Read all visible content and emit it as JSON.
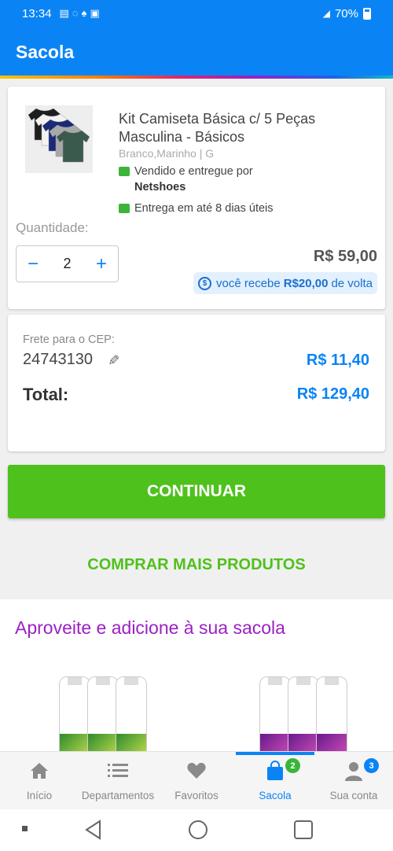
{
  "status_bar": {
    "time": "13:34",
    "notification_icons": [
      "notes-icon",
      "whatsapp-icon",
      "app-icon",
      "gallery-icon"
    ],
    "battery": "70%"
  },
  "header": {
    "title": "Sacola"
  },
  "product": {
    "title": "Kit Camiseta Básica c/ 5 Peças Masculina - Básicos",
    "variant": "Branco,Marinho | G",
    "seller_prefix": "Vendido e entregue por",
    "seller_name": "Netshoes",
    "delivery": "Entrega em até 8 dias úteis",
    "quantity_label": "Quantidade:",
    "quantity": "2",
    "price": "R$ 59,00",
    "cashback_prefix": "você recebe",
    "cashback_value": "R$20,00",
    "cashback_suffix": "de volta",
    "shirt_colors": [
      "#1e1e1e",
      "#f2f2f2",
      "#1a2a78",
      "#a8a8a8",
      "#3b5a4e"
    ]
  },
  "totals": {
    "cep_label": "Frete para o CEP:",
    "cep": "24743130",
    "frete_price": "R$ 11,40",
    "total_label": "Total:",
    "total_price": "R$ 129,40"
  },
  "actions": {
    "continue": "CONTINUAR",
    "buy_more": "COMPRAR MAIS PRODUTOS"
  },
  "suggestions": {
    "title": "Aproveite e adicione à sua sacola"
  },
  "bottom_nav": {
    "items": [
      {
        "label": "Início",
        "icon": "home-icon"
      },
      {
        "label": "Departamentos",
        "icon": "menu-icon"
      },
      {
        "label": "Favoritos",
        "icon": "heart-icon"
      },
      {
        "label": "Sacola",
        "icon": "bag-icon",
        "badge": "2",
        "active": true
      },
      {
        "label": "Sua conta",
        "icon": "user-icon",
        "badge": "3"
      }
    ]
  },
  "colors": {
    "primary": "#0a84f5",
    "green": "#4fc11c",
    "purple": "#9b21c2"
  }
}
